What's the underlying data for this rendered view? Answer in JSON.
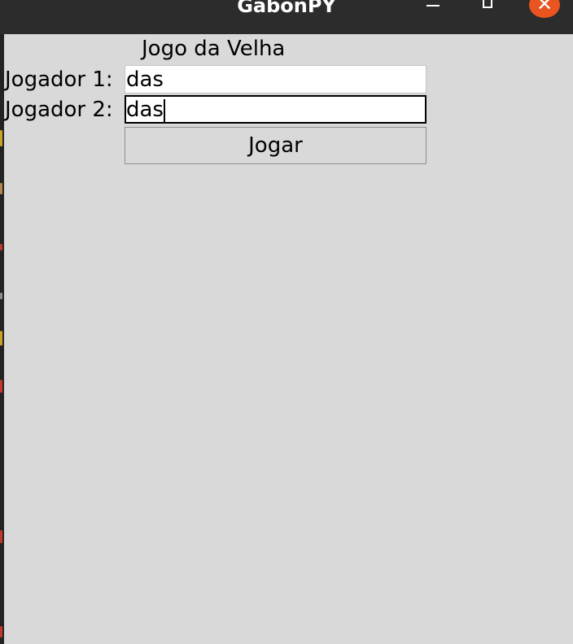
{
  "window": {
    "title": "GabonPY",
    "controls": {
      "minimize_icon": "minimize-icon",
      "maximize_icon": "maximize-icon",
      "close_icon": "close-icon",
      "close_glyph": "✕",
      "close_color": "#e95420"
    }
  },
  "form": {
    "heading": "Jogo da Velha",
    "player1_label": "Jogador 1:",
    "player1_value": "das",
    "player2_label": "Jogador 2:",
    "player2_value": "das",
    "play_button_label": "Jogar"
  },
  "colors": {
    "titlebar": "#2c2c2c",
    "content_background": "#d9d9d9",
    "accent": "#e95420"
  }
}
